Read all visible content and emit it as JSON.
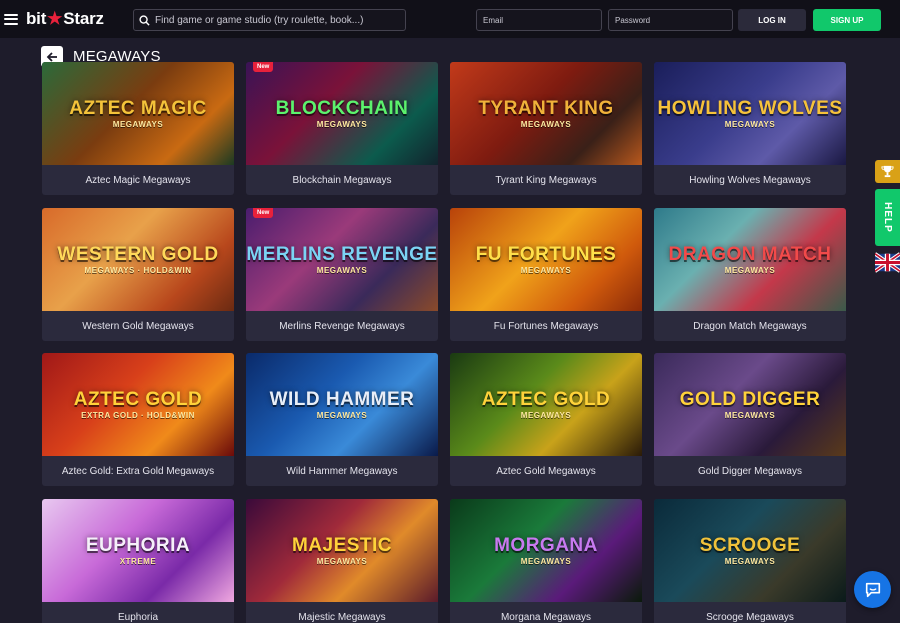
{
  "brand": {
    "logo_left": "bit",
    "logo_right": "Starz",
    "accent": "#e8213b"
  },
  "header": {
    "search_placeholder": "Find game or game studio (try roulette, book...)",
    "email_placeholder": "Email",
    "password_placeholder": "Password",
    "login_label": "LOG IN",
    "signup_label": "SIGN UP"
  },
  "page": {
    "title": "MEGAWAYS"
  },
  "games": [
    {
      "name": "Aztec Magic Megaways",
      "art_title": "AZTEC MAGIC",
      "art_sub": "MEGAWAYS",
      "badge": "",
      "bg": "linear-gradient(135deg,#2b6a3a 0%,#7a3c10 45%,#c96a12 75%,#1c3a22 100%)",
      "title_color": "#f4c33a"
    },
    {
      "name": "Blockchain Megaways",
      "art_title": "BLOCKCHAIN",
      "art_sub": "MEGAWAYS",
      "badge": "New",
      "bg": "linear-gradient(135deg,#3a1356 0%,#7a1239 40%,#0c5b4d 75%,#12232d 100%)",
      "title_color": "#5cf26d"
    },
    {
      "name": "Tyrant King Megaways",
      "art_title": "TYRANT KING",
      "art_sub": "MEGAWAYS",
      "badge": "",
      "bg": "linear-gradient(135deg,#c23a1a 0%,#7e1b10 45%,#3a2018 75%,#b8581d 100%)",
      "title_color": "#f0b23a"
    },
    {
      "name": "Howling Wolves Megaways",
      "art_title": "HOWLING WOLVES",
      "art_sub": "MEGAWAYS",
      "badge": "",
      "bg": "linear-gradient(135deg,#1a1e5a 0%,#3a3d8c 45%,#5e5aa8 70%,#1a1842 100%)",
      "title_color": "#f6c23a"
    },
    {
      "name": "Western Gold Megaways",
      "art_title": "WESTERN GOLD",
      "art_sub": "MEGAWAYS · HOLD&WIN",
      "badge": "",
      "bg": "linear-gradient(135deg,#d86a2a 0%,#e8a14a 40%,#b8471c 75%,#6a2a12 100%)",
      "title_color": "#ffd95a"
    },
    {
      "name": "Merlins Revenge Megaways",
      "art_title": "MERLINS REVENGE",
      "art_sub": "MEGAWAYS",
      "badge": "New",
      "bg": "linear-gradient(135deg,#4a1d6e 0%,#9a3a7a 40%,#3a2a5a 70%,#8a4a2a 100%)",
      "title_color": "#7bd3f4"
    },
    {
      "name": "Fu Fortunes Megaways",
      "art_title": "FU FORTUNES",
      "art_sub": "MEGAWAYS",
      "badge": "",
      "bg": "linear-gradient(135deg,#b8420a 0%,#f0a21a 45%,#d05a0c 75%,#8a2a08 100%)",
      "title_color": "#ffe04a"
    },
    {
      "name": "Dragon Match Megaways",
      "art_title": "DRAGON MATCH",
      "art_sub": "MEGAWAYS",
      "badge": "",
      "bg": "linear-gradient(135deg,#2e7a8a 0%,#6ab0b0 35%,#c4384a 65%,#3a5a4a 100%)",
      "title_color": "#f24a4a"
    },
    {
      "name": "Aztec Gold: Extra Gold Megaways",
      "art_title": "AZTEC GOLD",
      "art_sub": "EXTRA GOLD · HOLD&WIN",
      "badge": "",
      "bg": "linear-gradient(135deg,#a01818 0%,#d8401a 40%,#f08a1a 70%,#6a0a0a 100%)",
      "title_color": "#ffd23a"
    },
    {
      "name": "Wild Hammer Megaways",
      "art_title": "WILD HAMMER",
      "art_sub": "MEGAWAYS",
      "badge": "",
      "bg": "linear-gradient(135deg,#0a2a6a 0%,#1a5ab0 40%,#3a8ad8 65%,#0a1a4a 100%)",
      "title_color": "#e8eef8"
    },
    {
      "name": "Aztec Gold Megaways",
      "art_title": "AZTEC GOLD",
      "art_sub": "MEGAWAYS",
      "badge": "",
      "bg": "linear-gradient(135deg,#1a3a12 0%,#5a8a1a 40%,#c8a21a 65%,#2a1a08 100%)",
      "title_color": "#ffd23a"
    },
    {
      "name": "Gold Digger Megaways",
      "art_title": "GOLD DIGGER",
      "art_sub": "MEGAWAYS",
      "badge": "",
      "bg": "linear-gradient(135deg,#3a2a5a 0%,#6a4a8a 40%,#2a1a3a 70%,#5a3a1a 100%)",
      "title_color": "#ffd23a"
    },
    {
      "name": "Euphoria",
      "art_title": "EUPHORIA",
      "art_sub": "XTREME",
      "badge": "",
      "bg": "linear-gradient(135deg,#e8c8f0 0%,#c86ad8 40%,#7a2aa8 70%,#f0a8e0 100%)",
      "title_color": "#f6f0fa"
    },
    {
      "name": "Majestic Megaways",
      "art_title": "MAJESTIC",
      "art_sub": "MEGAWAYS",
      "badge": "",
      "bg": "linear-gradient(135deg,#3a0a3a 0%,#a02a3a 40%,#e08a2a 65%,#5a1a2a 100%)",
      "title_color": "#ffd23a"
    },
    {
      "name": "Morgana Megaways",
      "art_title": "MORGANA",
      "art_sub": "MEGAWAYS",
      "badge": "",
      "bg": "linear-gradient(135deg,#0a3a1a 0%,#1a7a3a 40%,#5a1a7a 70%,#0a1a0a 100%)",
      "title_color": "#c87af0"
    },
    {
      "name": "Scrooge Megaways",
      "art_title": "SCROOGE",
      "art_sub": "MEGAWAYS",
      "badge": "",
      "bg": "linear-gradient(135deg,#0a2a3a 0%,#1a4a5a 40%,#3a3a2a 70%,#0a1a1a 100%)",
      "title_color": "#f0c23a"
    }
  ],
  "widgets": {
    "help_label": "HELP"
  },
  "icons": {
    "menu": "menu-icon",
    "search": "search-icon",
    "back": "arrow-left-icon",
    "trophy": "trophy-icon",
    "flag": "uk-flag-icon",
    "chat": "chat-icon"
  }
}
